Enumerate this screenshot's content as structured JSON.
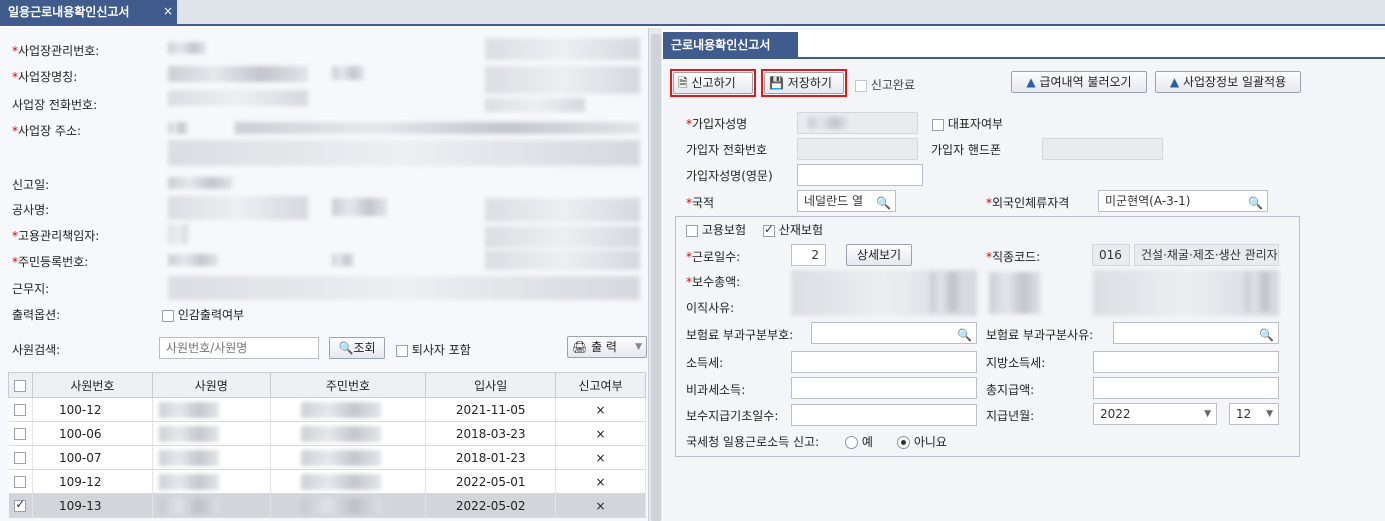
{
  "tab": {
    "title": "일용근로내용확인신고서",
    "close": "×"
  },
  "left": {
    "fields": [
      {
        "label": "사업장관리번호:",
        "required": true
      },
      {
        "label": "사업장명칭:",
        "required": true
      },
      {
        "label": "사업장 전화번호:",
        "required": false
      },
      {
        "label": "사업장 주소:",
        "required": true
      },
      {
        "label": "신고일:",
        "required": false
      },
      {
        "label": "공사명:",
        "required": false
      },
      {
        "label": "고용관리책임자:",
        "required": true
      },
      {
        "label": "주민등록번호:",
        "required": true
      },
      {
        "label": "근무지:",
        "required": false
      },
      {
        "label": "출력옵션:",
        "required": false
      }
    ],
    "print_option_label": "인감출력여부",
    "search_label": "사원검색:",
    "search_placeholder": "사원번호/사원명",
    "search_button": "조회",
    "include_retired_label": "퇴사자 포함",
    "print_button": "출 력",
    "table": {
      "columns": [
        "사원번호",
        "사원명",
        "주민번호",
        "입사일",
        "신고여부"
      ],
      "rows": [
        {
          "id": "100-12",
          "date": "2021-11-05",
          "reported": "×",
          "checked": false
        },
        {
          "id": "100-06",
          "date": "2018-03-23",
          "reported": "×",
          "checked": false
        },
        {
          "id": "100-07",
          "date": "2018-01-23",
          "reported": "×",
          "checked": false
        },
        {
          "id": "109-12",
          "date": "2022-05-01",
          "reported": "×",
          "checked": false
        },
        {
          "id": "109-13",
          "date": "2022-05-02",
          "reported": "×",
          "checked": true
        }
      ]
    }
  },
  "right": {
    "tab": "근로내용확인신고서",
    "toolbar": {
      "report": "신고하기",
      "save": "저장하기",
      "complete": "신고완료",
      "load_pay": "급여내역 불러오기",
      "apply_site": "사업장정보 일괄적용"
    },
    "insured_name_label": "가입자성명",
    "representative_label": "대표자여부",
    "insured_phone_label": "가입자 전화번호",
    "insured_mobile_label": "가입자 핸드폰",
    "insured_name_en_label": "가입자성명(영문)",
    "nationality_label": "국적",
    "nationality_value": "네덜란드 열",
    "residence_label": "외국인체류자격",
    "residence_value": "미군현역(A-3-1)",
    "employment_ins_label": "고용보험",
    "accident_ins_label": "산재보험",
    "work_days_label": "근로일수:",
    "work_days_value": "2",
    "detail_button": "상세보기",
    "job_code_label": "직종코드:",
    "job_code_value": "016",
    "job_name_value": "건설·채굴·제조·생산 관리자",
    "pay_total_label": "보수총액:",
    "leave_reason_label": "이직사유:",
    "premium_code_label": "보험료 부과구분부호:",
    "premium_reason_label": "보험료 부과구분사유:",
    "income_tax_label": "소득세:",
    "local_tax_label": "지방소득세:",
    "nontax_label": "비과세소득:",
    "total_pay_label": "총지급액:",
    "pay_base_days_label": "보수지급기초일수:",
    "pay_month_label": "지급년월:",
    "year_value": "2022",
    "month_value": "12",
    "nts_label": "국세청 일용근로소득 신고:",
    "yes_label": "예",
    "no_label": "아니요"
  }
}
